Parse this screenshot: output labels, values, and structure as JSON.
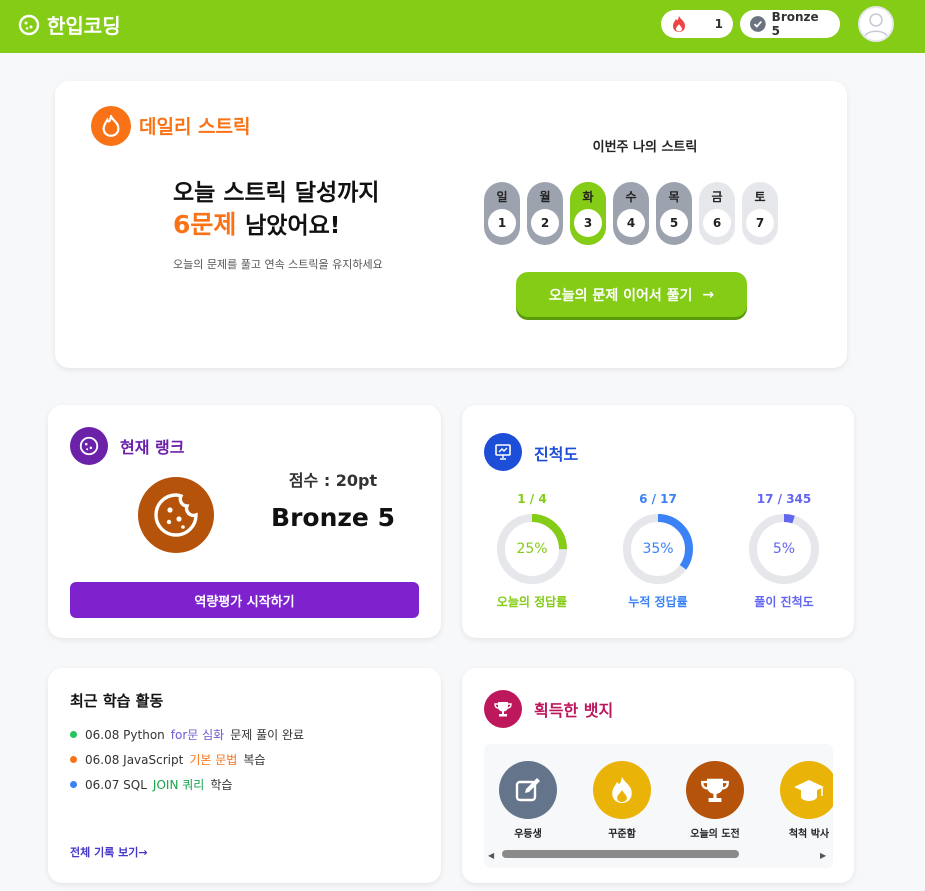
{
  "header": {
    "logo_text": "한입코딩",
    "streak_count": "1",
    "rank_badge": "Bronze 5",
    "brand_color": "#84cc16"
  },
  "streak": {
    "title": "데일리 스트릭",
    "headline_1": "오늘 스트릭 달성까지",
    "headline_count": "6문제",
    "headline_2": "남았어요!",
    "subtitle": "오늘의 문제를 풀고 연속 스트릭을 유지하세요",
    "week_title": "이번주 나의 스트릭",
    "days": [
      {
        "label": "일",
        "num": "1",
        "state": "done"
      },
      {
        "label": "월",
        "num": "2",
        "state": "done"
      },
      {
        "label": "화",
        "num": "3",
        "state": "today"
      },
      {
        "label": "수",
        "num": "4",
        "state": "done"
      },
      {
        "label": "목",
        "num": "5",
        "state": "done"
      },
      {
        "label": "금",
        "num": "6",
        "state": "future"
      },
      {
        "label": "토",
        "num": "7",
        "state": "future"
      }
    ],
    "cta_label": "오늘의 문제 이어서 풀기",
    "cta_arrow": "→"
  },
  "rank": {
    "title": "현재 랭크",
    "score_label": "점수 : 20pt",
    "rank_name": "Bronze 5",
    "button_label": "역량평가 시작하기"
  },
  "progress": {
    "title": "진척도",
    "rings": [
      {
        "count": "1 / 4",
        "percent_label": "25%",
        "percent": 25,
        "label": "오늘의 정답률",
        "color": "#84cc16"
      },
      {
        "count": "6 / 17",
        "percent_label": "35%",
        "percent": 35,
        "label": "누적 정답률",
        "color": "#3b82f6"
      },
      {
        "count": "17 / 345",
        "percent_label": "5%",
        "percent": 5,
        "label": "풀이 진척도",
        "color": "#6366f1"
      }
    ]
  },
  "activity": {
    "title": "최근 학습 활동",
    "items": [
      {
        "date": "06.08 Python",
        "topic": "for문 심화",
        "suffix": "문제 풀이 완료",
        "dot_color": "#22c55e",
        "topic_color": "#6d5bd0"
      },
      {
        "date": "06.08 JavaScript",
        "topic": "기본 문법",
        "suffix": "복습",
        "dot_color": "#f97316",
        "topic_color": "#f97316"
      },
      {
        "date": "06.07 SQL",
        "topic": "JOIN 쿼리",
        "suffix": "학습",
        "dot_color": "#3b82f6",
        "topic_color": "#16a34a"
      }
    ],
    "view_all": "전체 기록 보기→"
  },
  "badges": {
    "title": "획득한 뱃지",
    "items": [
      {
        "label": "우등생",
        "icon": "edit-icon",
        "color": "#64748b"
      },
      {
        "label": "꾸준함",
        "icon": "flame-icon",
        "color": "#eab308"
      },
      {
        "label": "오늘의 도전",
        "icon": "trophy-icon",
        "color": "#b45309"
      },
      {
        "label": "척척 박사",
        "icon": "graduation-cap-icon",
        "color": "#eab308"
      }
    ]
  }
}
